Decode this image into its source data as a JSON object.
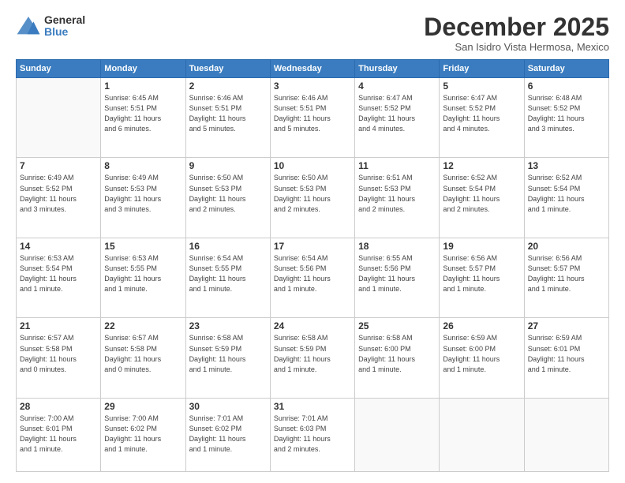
{
  "logo": {
    "general": "General",
    "blue": "Blue"
  },
  "header": {
    "month": "December 2025",
    "location": "San Isidro Vista Hermosa, Mexico"
  },
  "days_of_week": [
    "Sunday",
    "Monday",
    "Tuesday",
    "Wednesday",
    "Thursday",
    "Friday",
    "Saturday"
  ],
  "weeks": [
    [
      {
        "day": "",
        "info": ""
      },
      {
        "day": "1",
        "info": "Sunrise: 6:45 AM\nSunset: 5:51 PM\nDaylight: 11 hours\nand 6 minutes."
      },
      {
        "day": "2",
        "info": "Sunrise: 6:46 AM\nSunset: 5:51 PM\nDaylight: 11 hours\nand 5 minutes."
      },
      {
        "day": "3",
        "info": "Sunrise: 6:46 AM\nSunset: 5:51 PM\nDaylight: 11 hours\nand 5 minutes."
      },
      {
        "day": "4",
        "info": "Sunrise: 6:47 AM\nSunset: 5:52 PM\nDaylight: 11 hours\nand 4 minutes."
      },
      {
        "day": "5",
        "info": "Sunrise: 6:47 AM\nSunset: 5:52 PM\nDaylight: 11 hours\nand 4 minutes."
      },
      {
        "day": "6",
        "info": "Sunrise: 6:48 AM\nSunset: 5:52 PM\nDaylight: 11 hours\nand 3 minutes."
      }
    ],
    [
      {
        "day": "7",
        "info": "Sunrise: 6:49 AM\nSunset: 5:52 PM\nDaylight: 11 hours\nand 3 minutes."
      },
      {
        "day": "8",
        "info": "Sunrise: 6:49 AM\nSunset: 5:53 PM\nDaylight: 11 hours\nand 3 minutes."
      },
      {
        "day": "9",
        "info": "Sunrise: 6:50 AM\nSunset: 5:53 PM\nDaylight: 11 hours\nand 2 minutes."
      },
      {
        "day": "10",
        "info": "Sunrise: 6:50 AM\nSunset: 5:53 PM\nDaylight: 11 hours\nand 2 minutes."
      },
      {
        "day": "11",
        "info": "Sunrise: 6:51 AM\nSunset: 5:53 PM\nDaylight: 11 hours\nand 2 minutes."
      },
      {
        "day": "12",
        "info": "Sunrise: 6:52 AM\nSunset: 5:54 PM\nDaylight: 11 hours\nand 2 minutes."
      },
      {
        "day": "13",
        "info": "Sunrise: 6:52 AM\nSunset: 5:54 PM\nDaylight: 11 hours\nand 1 minute."
      }
    ],
    [
      {
        "day": "14",
        "info": "Sunrise: 6:53 AM\nSunset: 5:54 PM\nDaylight: 11 hours\nand 1 minute."
      },
      {
        "day": "15",
        "info": "Sunrise: 6:53 AM\nSunset: 5:55 PM\nDaylight: 11 hours\nand 1 minute."
      },
      {
        "day": "16",
        "info": "Sunrise: 6:54 AM\nSunset: 5:55 PM\nDaylight: 11 hours\nand 1 minute."
      },
      {
        "day": "17",
        "info": "Sunrise: 6:54 AM\nSunset: 5:56 PM\nDaylight: 11 hours\nand 1 minute."
      },
      {
        "day": "18",
        "info": "Sunrise: 6:55 AM\nSunset: 5:56 PM\nDaylight: 11 hours\nand 1 minute."
      },
      {
        "day": "19",
        "info": "Sunrise: 6:56 AM\nSunset: 5:57 PM\nDaylight: 11 hours\nand 1 minute."
      },
      {
        "day": "20",
        "info": "Sunrise: 6:56 AM\nSunset: 5:57 PM\nDaylight: 11 hours\nand 1 minute."
      }
    ],
    [
      {
        "day": "21",
        "info": "Sunrise: 6:57 AM\nSunset: 5:58 PM\nDaylight: 11 hours\nand 0 minutes."
      },
      {
        "day": "22",
        "info": "Sunrise: 6:57 AM\nSunset: 5:58 PM\nDaylight: 11 hours\nand 0 minutes."
      },
      {
        "day": "23",
        "info": "Sunrise: 6:58 AM\nSunset: 5:59 PM\nDaylight: 11 hours\nand 1 minute."
      },
      {
        "day": "24",
        "info": "Sunrise: 6:58 AM\nSunset: 5:59 PM\nDaylight: 11 hours\nand 1 minute."
      },
      {
        "day": "25",
        "info": "Sunrise: 6:58 AM\nSunset: 6:00 PM\nDaylight: 11 hours\nand 1 minute."
      },
      {
        "day": "26",
        "info": "Sunrise: 6:59 AM\nSunset: 6:00 PM\nDaylight: 11 hours\nand 1 minute."
      },
      {
        "day": "27",
        "info": "Sunrise: 6:59 AM\nSunset: 6:01 PM\nDaylight: 11 hours\nand 1 minute."
      }
    ],
    [
      {
        "day": "28",
        "info": "Sunrise: 7:00 AM\nSunset: 6:01 PM\nDaylight: 11 hours\nand 1 minute."
      },
      {
        "day": "29",
        "info": "Sunrise: 7:00 AM\nSunset: 6:02 PM\nDaylight: 11 hours\nand 1 minute."
      },
      {
        "day": "30",
        "info": "Sunrise: 7:01 AM\nSunset: 6:02 PM\nDaylight: 11 hours\nand 1 minute."
      },
      {
        "day": "31",
        "info": "Sunrise: 7:01 AM\nSunset: 6:03 PM\nDaylight: 11 hours\nand 2 minutes."
      },
      {
        "day": "",
        "info": ""
      },
      {
        "day": "",
        "info": ""
      },
      {
        "day": "",
        "info": ""
      }
    ]
  ]
}
